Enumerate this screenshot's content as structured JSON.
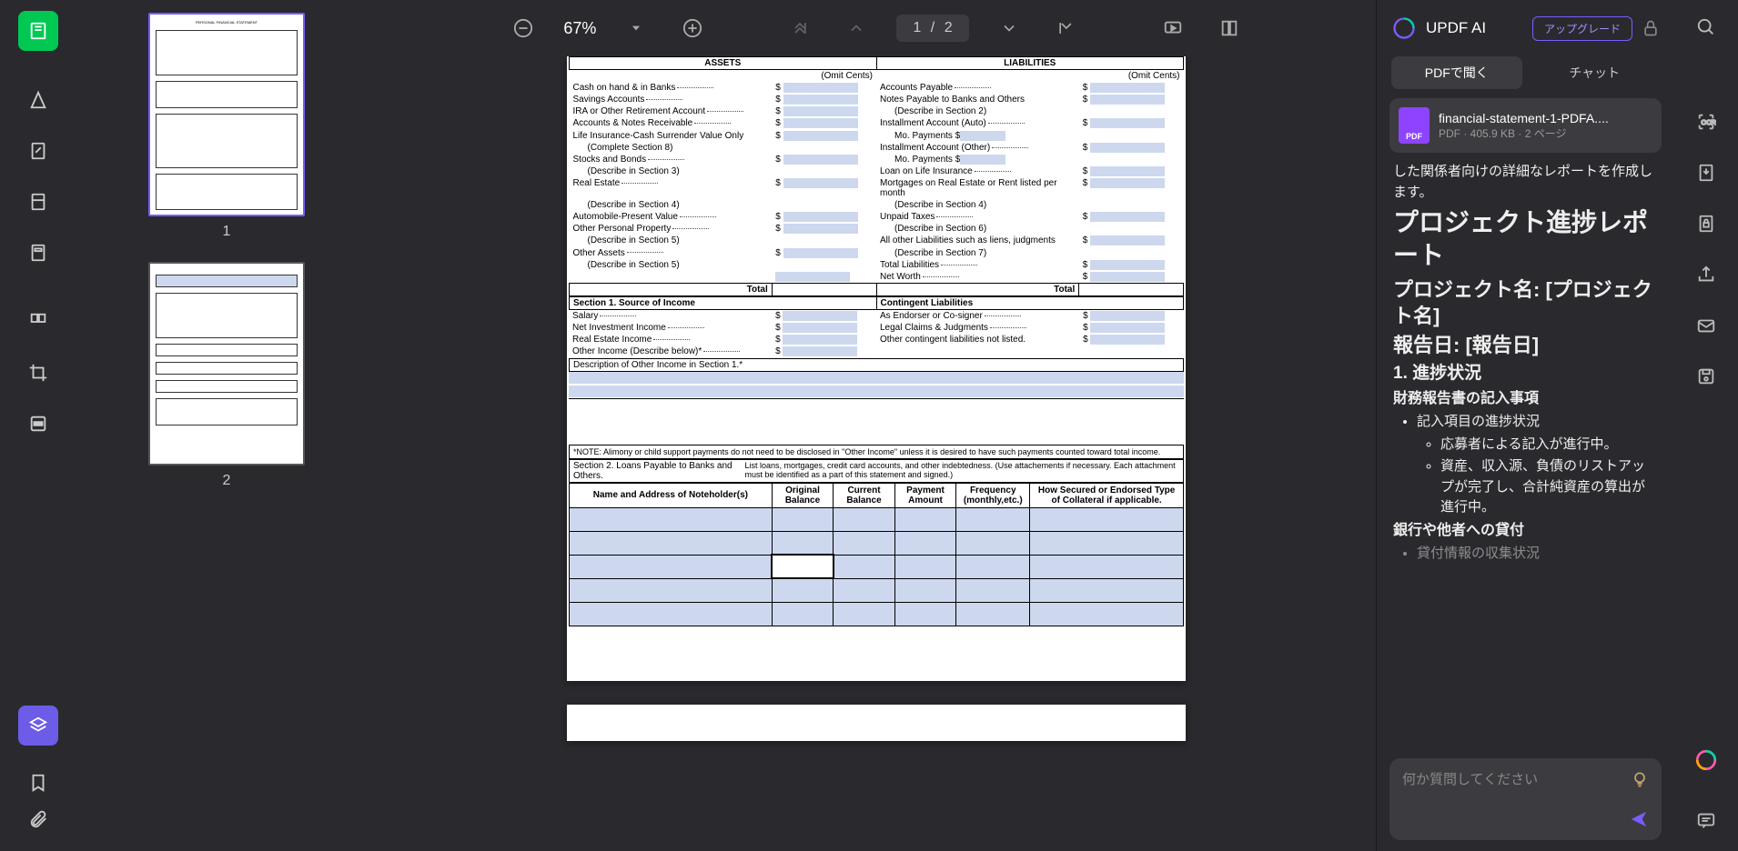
{
  "toolbar": {
    "zoom": "67%",
    "page_current": "1",
    "page_sep": "/",
    "page_total": "2"
  },
  "thumbnails": {
    "p1": "1",
    "p2": "2"
  },
  "doc": {
    "assets_hdr": "ASSETS",
    "liab_hdr": "LIABILITIES",
    "omit1": "(Omit Cents)",
    "omit2": "(Omit Cents)",
    "a_cash": "Cash on hand & in Banks",
    "a_savings": "Savings Accounts",
    "a_ira": "IRA or Other Retirement Account",
    "a_notes": "Accounts & Notes Receivable",
    "a_life": "Life Insurance-Cash Surrender Value Only",
    "a_life_sub": "(Complete Section 8)",
    "a_stocks": "Stocks and Bonds",
    "a_stocks_sub": "(Describe in Section 3)",
    "a_real": "Real Estate",
    "a_real_sub": "(Describe in Section 4)",
    "a_auto": "Automobile-Present Value",
    "a_other_pp": "Other Personal Property",
    "a_other_pp_sub": "(Describe in Section 5)",
    "a_other_assets": "Other Assets",
    "a_other_assets_sub": "(Describe in Section 5)",
    "a_total": "Total",
    "l_ap": "Accounts Payable",
    "l_notes": "Notes Payable to Banks and Others",
    "l_notes_sub": "(Describe in Section 2)",
    "l_inst_auto": "Installment Account (Auto)",
    "l_mo1": "Mo. Payments",
    "l_inst_other": "Installment Account (Other)",
    "l_mo2": "Mo. Payments",
    "l_loan_life": "Loan on Life Insurance",
    "l_mort": "Mortgages on Real Estate or Rent listed per month",
    "l_mort_sub": "(Describe in Section 4)",
    "l_unpaid": "Unpaid Taxes",
    "l_unpaid_sub": "(Describe in Section 6)",
    "l_other": "All other Liabilities such as liens, judgments",
    "l_other_sub": "(Describe in Section 7)",
    "l_total_liab": "Total Liabilities",
    "l_networth": "Net Worth",
    "l_total": "Total",
    "s1_hdr": "Section 1.      Source of Income",
    "cl_hdr": "Contingent Liabilities",
    "s1_salary": "Salary",
    "s1_nii": "Net Investment Income",
    "s1_rei": "Real Estate Income",
    "s1_other": "Other Income (Describe below)*",
    "cl_endorser": "As Endorser or Co-signer",
    "cl_legal": "Legal Claims & Judgments",
    "cl_other": "Other contingent liabilities not listed.",
    "desc_other": "Description of Other Income in Section 1.*",
    "note": "*NOTE: Alimony or child support payments do not need to be disclosed in \"Other Income\" unless it is desired to have such payments counted toward total income.",
    "s2_hdr": "Section 2. Loans Payable to Banks and Others.",
    "s2_text": "List loans, mortgages, credit card accounts, and other indebtedness. (Use attachements if necessary. Each attachment must be identified as a part of this statement and signed.)",
    "s2_c1": "Name and Address of Noteholder(s)",
    "s2_c2": "Original Balance",
    "s2_c3": "Current Balance",
    "s2_c4": "Payment Amount",
    "s2_c5": "Frequency (monthly,etc.)",
    "s2_c6": "How Secured or Endorsed Type of Collateral if applicable.",
    "dollar": "$"
  },
  "ai": {
    "title": "UPDF AI",
    "upgrade": "アップグレード",
    "tab_pdf": "PDFで聞く",
    "tab_chat": "チャット",
    "file_name": "financial-statement-1-PDFA....",
    "file_tag": "PDF",
    "file_meta": "PDF · 405.9 KB · 2 ページ",
    "pre_text": "した関係者向けの詳細なレポートを作成します。",
    "h1": "プロジェクト進捗レポート",
    "h2a": "プロジェクト名: [プロジェクト名]",
    "h2b": "報告日: [報告日]",
    "h3": "1. 進捗状況",
    "h4a": "財務報告書の記入事項",
    "li1": "記入項目の進捗状況",
    "li1a": "応募者による記入が進行中。",
    "li1b": "資産、収入源、負債のリストアップが完了し、合計純資産の算出が進行中。",
    "h4b": "銀行や他者への貸付",
    "li2": "貸付情報の収集状況",
    "placeholder": "何か質問してください"
  }
}
